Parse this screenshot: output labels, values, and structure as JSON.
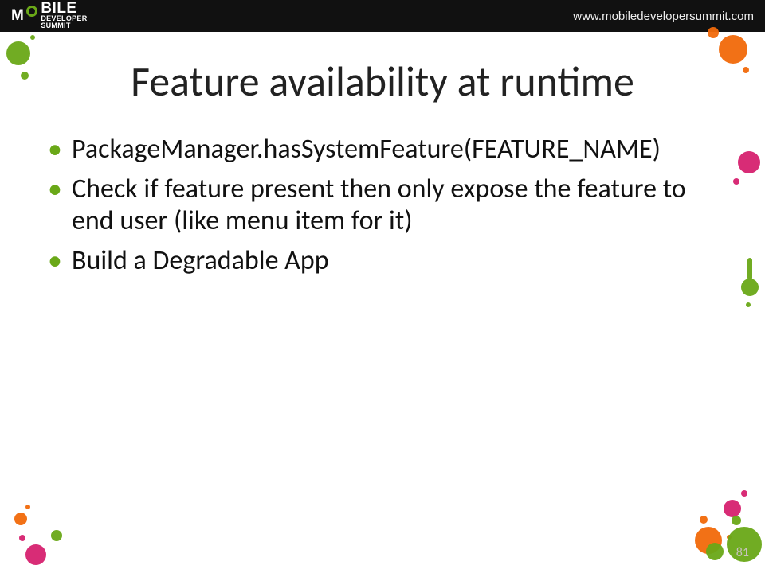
{
  "header": {
    "logo": {
      "line1": "M  BILE",
      "line2": "DEVELOPER",
      "line3": "SUMMIT"
    },
    "url": "www.mobiledevelopersummit.com"
  },
  "slide": {
    "title": "Feature availability at runtime",
    "bullets": [
      "PackageManager.hasSystemFeature(FEATURE_NAME)",
      "Check if feature present then only expose the feature to end user (like menu item for it)",
      "Build a Degradable App"
    ],
    "page_number": "81"
  }
}
